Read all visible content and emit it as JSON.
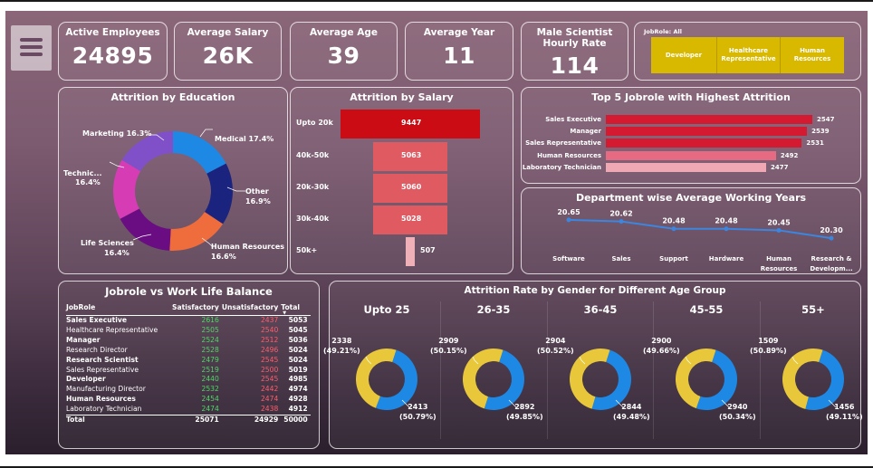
{
  "kpis": [
    {
      "title": "Active Employees",
      "value": "24895"
    },
    {
      "title": "Average Salary",
      "value": "26K"
    },
    {
      "title": "Average Age",
      "value": "39"
    },
    {
      "title": "Average Year",
      "value": "11"
    },
    {
      "title": "Male Scientist Hourly Rate",
      "value": "114"
    }
  ],
  "slicer": {
    "title": "JobRole: All",
    "options": [
      "Developer",
      "Healthcare Representative",
      "Human Resources"
    ]
  },
  "education": {
    "title": "Attrition by Education",
    "labels": {
      "marketing": "Marketing 16.3%",
      "medical": "Medical 17.4%",
      "technical_1": "Technic...",
      "technical_2": "16.4%",
      "other_1": "Other",
      "other_2": "16.9%",
      "life_1": "Life Sciences",
      "life_2": "16.4%",
      "hr_1": "Human Resources",
      "hr_2": "16.6%"
    },
    "chart_data": {
      "type": "pie",
      "categories": [
        "Medical",
        "Other",
        "Human Resources",
        "Life Sciences",
        "Technical Degree",
        "Marketing"
      ],
      "values": [
        17.4,
        16.9,
        16.6,
        16.4,
        16.4,
        16.3
      ],
      "colors": [
        "#1e88e5",
        "#1a237e",
        "#ef6c3c",
        "#6a0d83",
        "#d63db5",
        "#8050c8"
      ]
    }
  },
  "salary": {
    "title": "Attrition by Salary",
    "chart_data": {
      "type": "bar",
      "categories": [
        "Upto 20k",
        "40k-50k",
        "20k-30k",
        "30k-40k",
        "50k+"
      ],
      "values": [
        9447,
        5063,
        5060,
        5028,
        507
      ]
    }
  },
  "top_roles": {
    "title": "Top 5 Jobrole with Highest Attrition",
    "chart_data": {
      "type": "bar",
      "categories": [
        "Sales Executive",
        "Manager",
        "Sales Representative",
        "Human Resources",
        "Laboratory Technician"
      ],
      "values": [
        2547,
        2539,
        2531,
        2492,
        2477
      ]
    }
  },
  "dept_years": {
    "title": "Department wise Average Working Years",
    "chart_data": {
      "type": "line",
      "categories": [
        "Software",
        "Sales",
        "Support",
        "Hardware",
        "Human Resources",
        "Research & Developm..."
      ],
      "values": [
        20.65,
        20.62,
        20.48,
        20.48,
        20.45,
        20.3
      ],
      "value_labels": [
        "20.65",
        "20.62",
        "20.48",
        "20.48",
        "20.45",
        "20.30"
      ]
    }
  },
  "worklife": {
    "title": "Jobrole vs Work Life Balance",
    "headers": [
      "JobRole",
      "Satisfactory",
      "Unsatisfactory",
      "Total"
    ],
    "rows": [
      {
        "role": "Sales Executive",
        "sat": "2616",
        "uns": "2437",
        "total": "5053",
        "bold": true
      },
      {
        "role": "Healthcare Representative",
        "sat": "2505",
        "uns": "2540",
        "total": "5045",
        "bold": false
      },
      {
        "role": "Manager",
        "sat": "2524",
        "uns": "2512",
        "total": "5036",
        "bold": true
      },
      {
        "role": "Research Director",
        "sat": "2528",
        "uns": "2496",
        "total": "5024",
        "bold": false
      },
      {
        "role": "Research Scientist",
        "sat": "2479",
        "uns": "2545",
        "total": "5024",
        "bold": true
      },
      {
        "role": "Sales Representative",
        "sat": "2519",
        "uns": "2500",
        "total": "5019",
        "bold": false
      },
      {
        "role": "Developer",
        "sat": "2440",
        "uns": "2545",
        "total": "4985",
        "bold": true
      },
      {
        "role": "Manufacturing Director",
        "sat": "2532",
        "uns": "2442",
        "total": "4974",
        "bold": false
      },
      {
        "role": "Human Resources",
        "sat": "2454",
        "uns": "2474",
        "total": "4928",
        "bold": true
      },
      {
        "role": "Laboratory Technician",
        "sat": "2474",
        "uns": "2438",
        "total": "4912",
        "bold": false
      },
      {
        "role": "Total",
        "sat": "25071",
        "uns": "24929",
        "total": "50000",
        "bold": true
      }
    ]
  },
  "gender_age": {
    "title": "Attrition Rate by Gender for Different Age Group",
    "colors": {
      "female": "#e8c83a",
      "male": "#1e88e5"
    },
    "groups": [
      {
        "age": "Upto 25",
        "yellow": 2338,
        "yellow_pct": "(49.21%)",
        "blue": 2413,
        "blue_pct": "(50.79%)"
      },
      {
        "age": "26-35",
        "yellow": 2909,
        "yellow_pct": "(50.15%)",
        "blue": 2892,
        "blue_pct": "(49.85%)"
      },
      {
        "age": "36-45",
        "yellow": 2904,
        "yellow_pct": "(50.52%)",
        "blue": 2844,
        "blue_pct": "(49.48%)"
      },
      {
        "age": "45-55",
        "yellow": 2900,
        "yellow_pct": "(49.66%)",
        "blue": 2940,
        "blue_pct": "(50.34%)"
      },
      {
        "age": "55+",
        "yellow": 1509,
        "yellow_pct": "(50.89%)",
        "blue": 1456,
        "blue_pct": "(49.11%)"
      }
    ]
  },
  "icons": {
    "menu": "hamburger-menu-icon",
    "sort": "sort-descending-icon"
  }
}
